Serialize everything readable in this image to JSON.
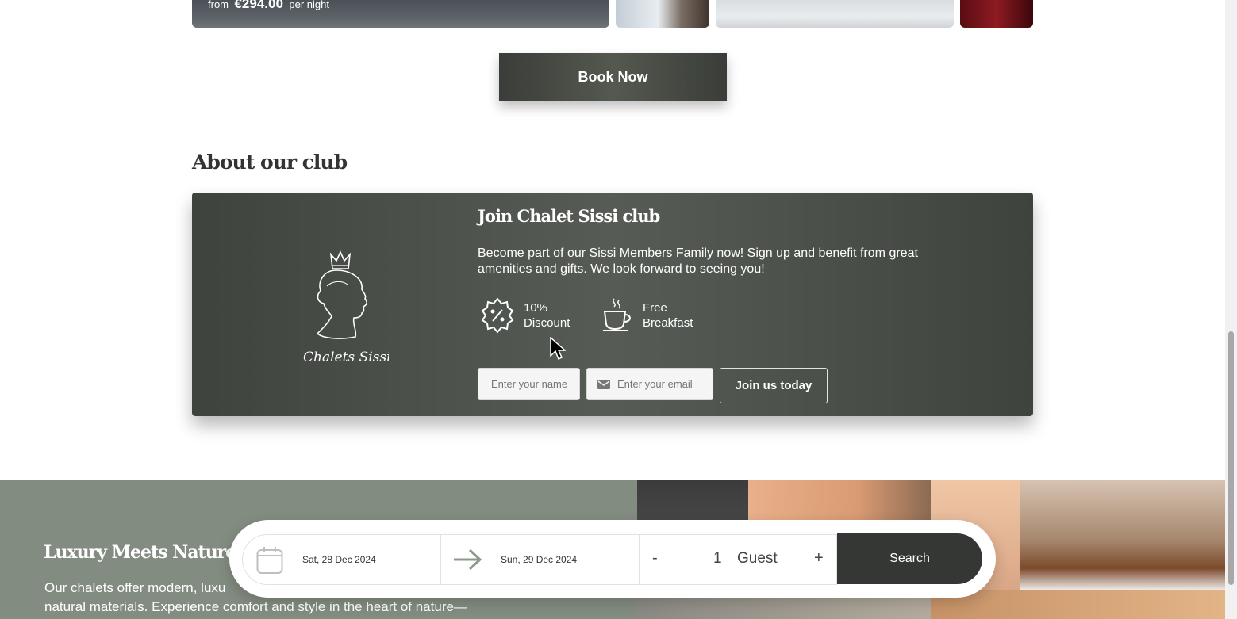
{
  "top_strip": {
    "from_label": "from",
    "price": "€294.00",
    "per_night_label": "per night"
  },
  "book_now_label": "Book Now",
  "about_section": {
    "title": "About our club"
  },
  "club": {
    "logo_text": "Chalets Sissi",
    "title": "Join Chalet Sissi club",
    "description": "Become part of our Sissi Members Family now! Sign up and benefit from great amenities and gifts. We look forward to seeing you!",
    "perks": [
      {
        "icon": "discount-badge-icon",
        "label": "10% Discount"
      },
      {
        "icon": "coffee-cup-icon",
        "label": "Free Breakfast"
      }
    ],
    "name_placeholder": "Enter your name",
    "email_placeholder": "Enter your email",
    "join_button": "Join us today"
  },
  "luxury_section": {
    "title": "Luxury Meets Nature",
    "text": "Our chalets offer modern, luxu… natural materials. Experience comfort and style in the heart of nature—",
    "text_line1": "Our chalets offer modern, luxu",
    "text_line2": "natural materials. Experience comfort and style in the heart of nature—"
  },
  "booking_widget": {
    "checkin": "Sat, 28 Dec 2024",
    "checkout": "Sun, 29 Dec 2024",
    "guests_minus": "-",
    "guests_count": "1",
    "guests_label": "Guest",
    "guests_plus": "+",
    "search_button": "Search"
  },
  "colors": {
    "dark_accent": "#353735",
    "sage_green": "#838c81"
  }
}
